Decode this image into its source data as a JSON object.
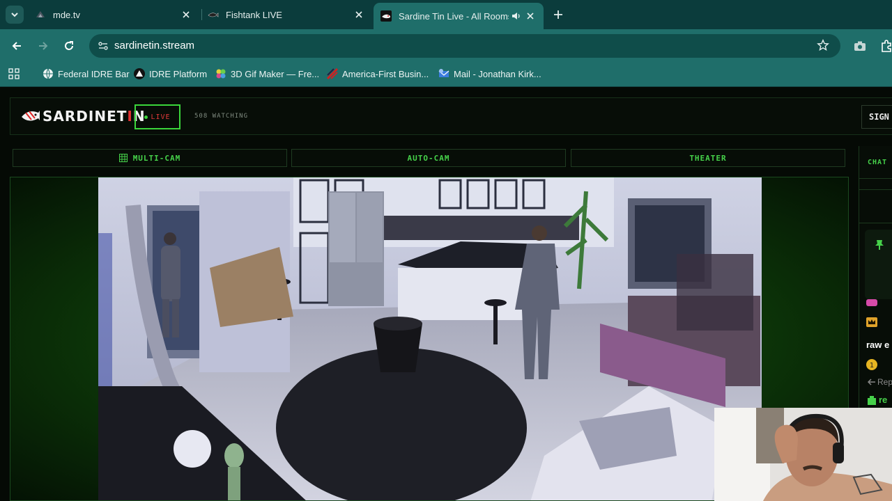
{
  "browser": {
    "tabs": [
      {
        "title": "mde.tv",
        "icon": "mde-favicon",
        "active": false
      },
      {
        "title": "Fishtank LIVE",
        "icon": "fishtank-favicon",
        "active": false
      },
      {
        "title": "Sardine Tin Live - All Rooms",
        "icon": "sardinetin-favicon",
        "active": true,
        "audio": true
      }
    ],
    "url": "sardinetin.stream",
    "bookmarks": [
      {
        "label": "Federal IDRE Bar",
        "icon": "globe-icon"
      },
      {
        "label": "IDRE Platform",
        "icon": "triangle-logo-icon"
      },
      {
        "label": "3D Gif Maker — Fre...",
        "icon": "gif-maker-icon"
      },
      {
        "label": "America-First Busin...",
        "icon": "flag-icon"
      },
      {
        "label": "Mail - Jonathan Kirk...",
        "icon": "mail-icon"
      }
    ]
  },
  "site": {
    "logo": {
      "prefix": "SARDINET",
      "accent": "I",
      "suffix": "N"
    },
    "live_label": "LIVE",
    "watching": "508 WATCHING",
    "signin": "SIGN",
    "modes": [
      "MULTI-CAM",
      "AUTO-CAM",
      "THEATER"
    ],
    "chat": {
      "tab": "CHAT",
      "messages": [
        "raw e",
        "Rep",
        "re"
      ]
    }
  },
  "colors": {
    "accent_green": "#46d14a",
    "live_red": "#e23a3a",
    "chrome_teal": "#1f6e6a"
  }
}
